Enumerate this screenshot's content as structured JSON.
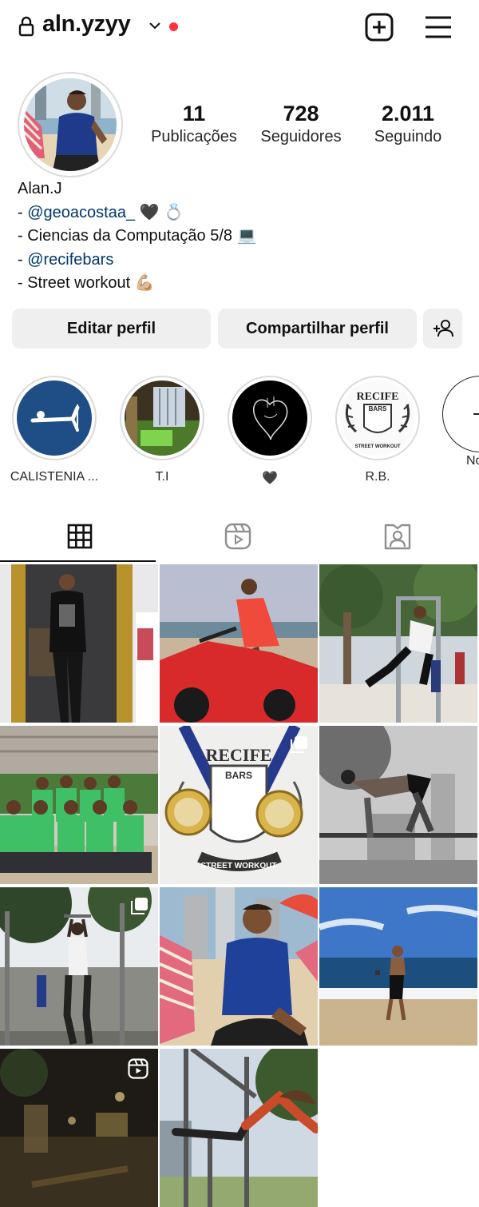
{
  "header": {
    "username": "aln.yzyy",
    "icons": [
      "lock-icon",
      "chevron-down-icon",
      "notification-dot",
      "new-post-icon",
      "menu-icon"
    ]
  },
  "profile": {
    "stats": [
      {
        "value": "11",
        "label": "Publicações"
      },
      {
        "value": "728",
        "label": "Seguidores"
      },
      {
        "value": "2.011",
        "label": "Seguindo"
      }
    ],
    "name": "Alan.J",
    "bio": {
      "line1_prefix": "- ",
      "line1_link": "@geoacostaa_",
      "line1_emoji": "🖤 💍",
      "line2": "- Ciencias da Computação 5/8 💻",
      "line3_prefix": "- ",
      "line3_link": "@recifebars",
      "line4": "- Street workout 💪🏼"
    }
  },
  "actions": {
    "edit": "Editar perfil",
    "share": "Compartilhar perfil"
  },
  "highlights": [
    {
      "label": "CALISTENIA ..."
    },
    {
      "label": "T.I"
    },
    {
      "label": "🖤"
    },
    {
      "label": "R.B."
    },
    {
      "label": "No"
    }
  ],
  "highlight_art": {
    "rb_top": "RECIFE",
    "rb_mid": "BARS",
    "rb_bottom": "STREET WORKOUT"
  },
  "tabs": [
    "grid-icon",
    "reels-icon",
    "tagged-icon"
  ],
  "posts": [
    {
      "desc": "mirror selfie"
    },
    {
      "desc": "quad bike"
    },
    {
      "desc": "pull-up bars park"
    },
    {
      "desc": "group photo"
    },
    {
      "desc": "medals",
      "badge": "carousel-icon"
    },
    {
      "desc": "bw street workout"
    },
    {
      "desc": "bar hang",
      "badge": "carousel-icon"
    },
    {
      "desc": "beach chair"
    },
    {
      "desc": "beach"
    },
    {
      "desc": "night video",
      "badge": "reels-icon"
    },
    {
      "desc": "bars lever"
    }
  ],
  "post_art": {
    "medal_top": "RECIFE",
    "medal_mid": "BARS",
    "medal_bottom": "STREET WORKOUT"
  }
}
